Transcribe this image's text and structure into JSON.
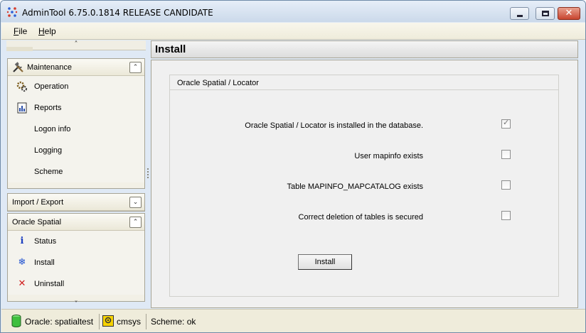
{
  "window": {
    "title": "AdminTool 6.75.0.1814 RELEASE CANDIDATE",
    "minimize_glyph": "",
    "close_glyph": "✕"
  },
  "menu": {
    "file": "File",
    "help": "Help"
  },
  "sidebar": {
    "scroll_up": "˄",
    "scroll_down": "˅",
    "maintenance": {
      "title": "Maintenance",
      "items": [
        {
          "label": "Operation",
          "icon": "gears-icon"
        },
        {
          "label": "Reports",
          "icon": "report-icon"
        },
        {
          "label": "Logon info",
          "icon": ""
        },
        {
          "label": "Logging",
          "icon": ""
        },
        {
          "label": "Scheme",
          "icon": ""
        }
      ]
    },
    "import_export": {
      "title": "Import / Export"
    },
    "oracle_spatial": {
      "title": "Oracle Spatial",
      "items": [
        {
          "label": "Status",
          "icon": "info-icon",
          "glyph": "i"
        },
        {
          "label": "Install",
          "icon": "install-icon",
          "glyph": "❄"
        },
        {
          "label": "Uninstall",
          "icon": "uninstall-icon",
          "glyph": "✕"
        }
      ]
    },
    "expand_glyph": "⌄",
    "collapse_glyph": "⌃"
  },
  "content": {
    "title": "Install",
    "group_title": "Oracle Spatial / Locator",
    "checks": [
      {
        "label": "Oracle Spatial / Locator is installed in the database.",
        "checked": true
      },
      {
        "label": "User mapinfo exists",
        "checked": false
      },
      {
        "label": "Table MAPINFO_MAPCATALOG exists",
        "checked": false
      },
      {
        "label": "Correct deletion of tables is secured",
        "checked": false
      }
    ],
    "install_button": "Install",
    "check_glyph": "✓"
  },
  "status": {
    "connection": "Oracle: spatialtest",
    "user": "cmsys",
    "scheme": "Scheme: ok"
  },
  "colors": {
    "title_bg": "#dfe9f5",
    "menubar_bg": "#efecdb",
    "panel_bg": "#f4f3ed",
    "close_red": "#c8452f",
    "db_green": "#3fbf3f",
    "user_yellow": "#f6d200"
  }
}
